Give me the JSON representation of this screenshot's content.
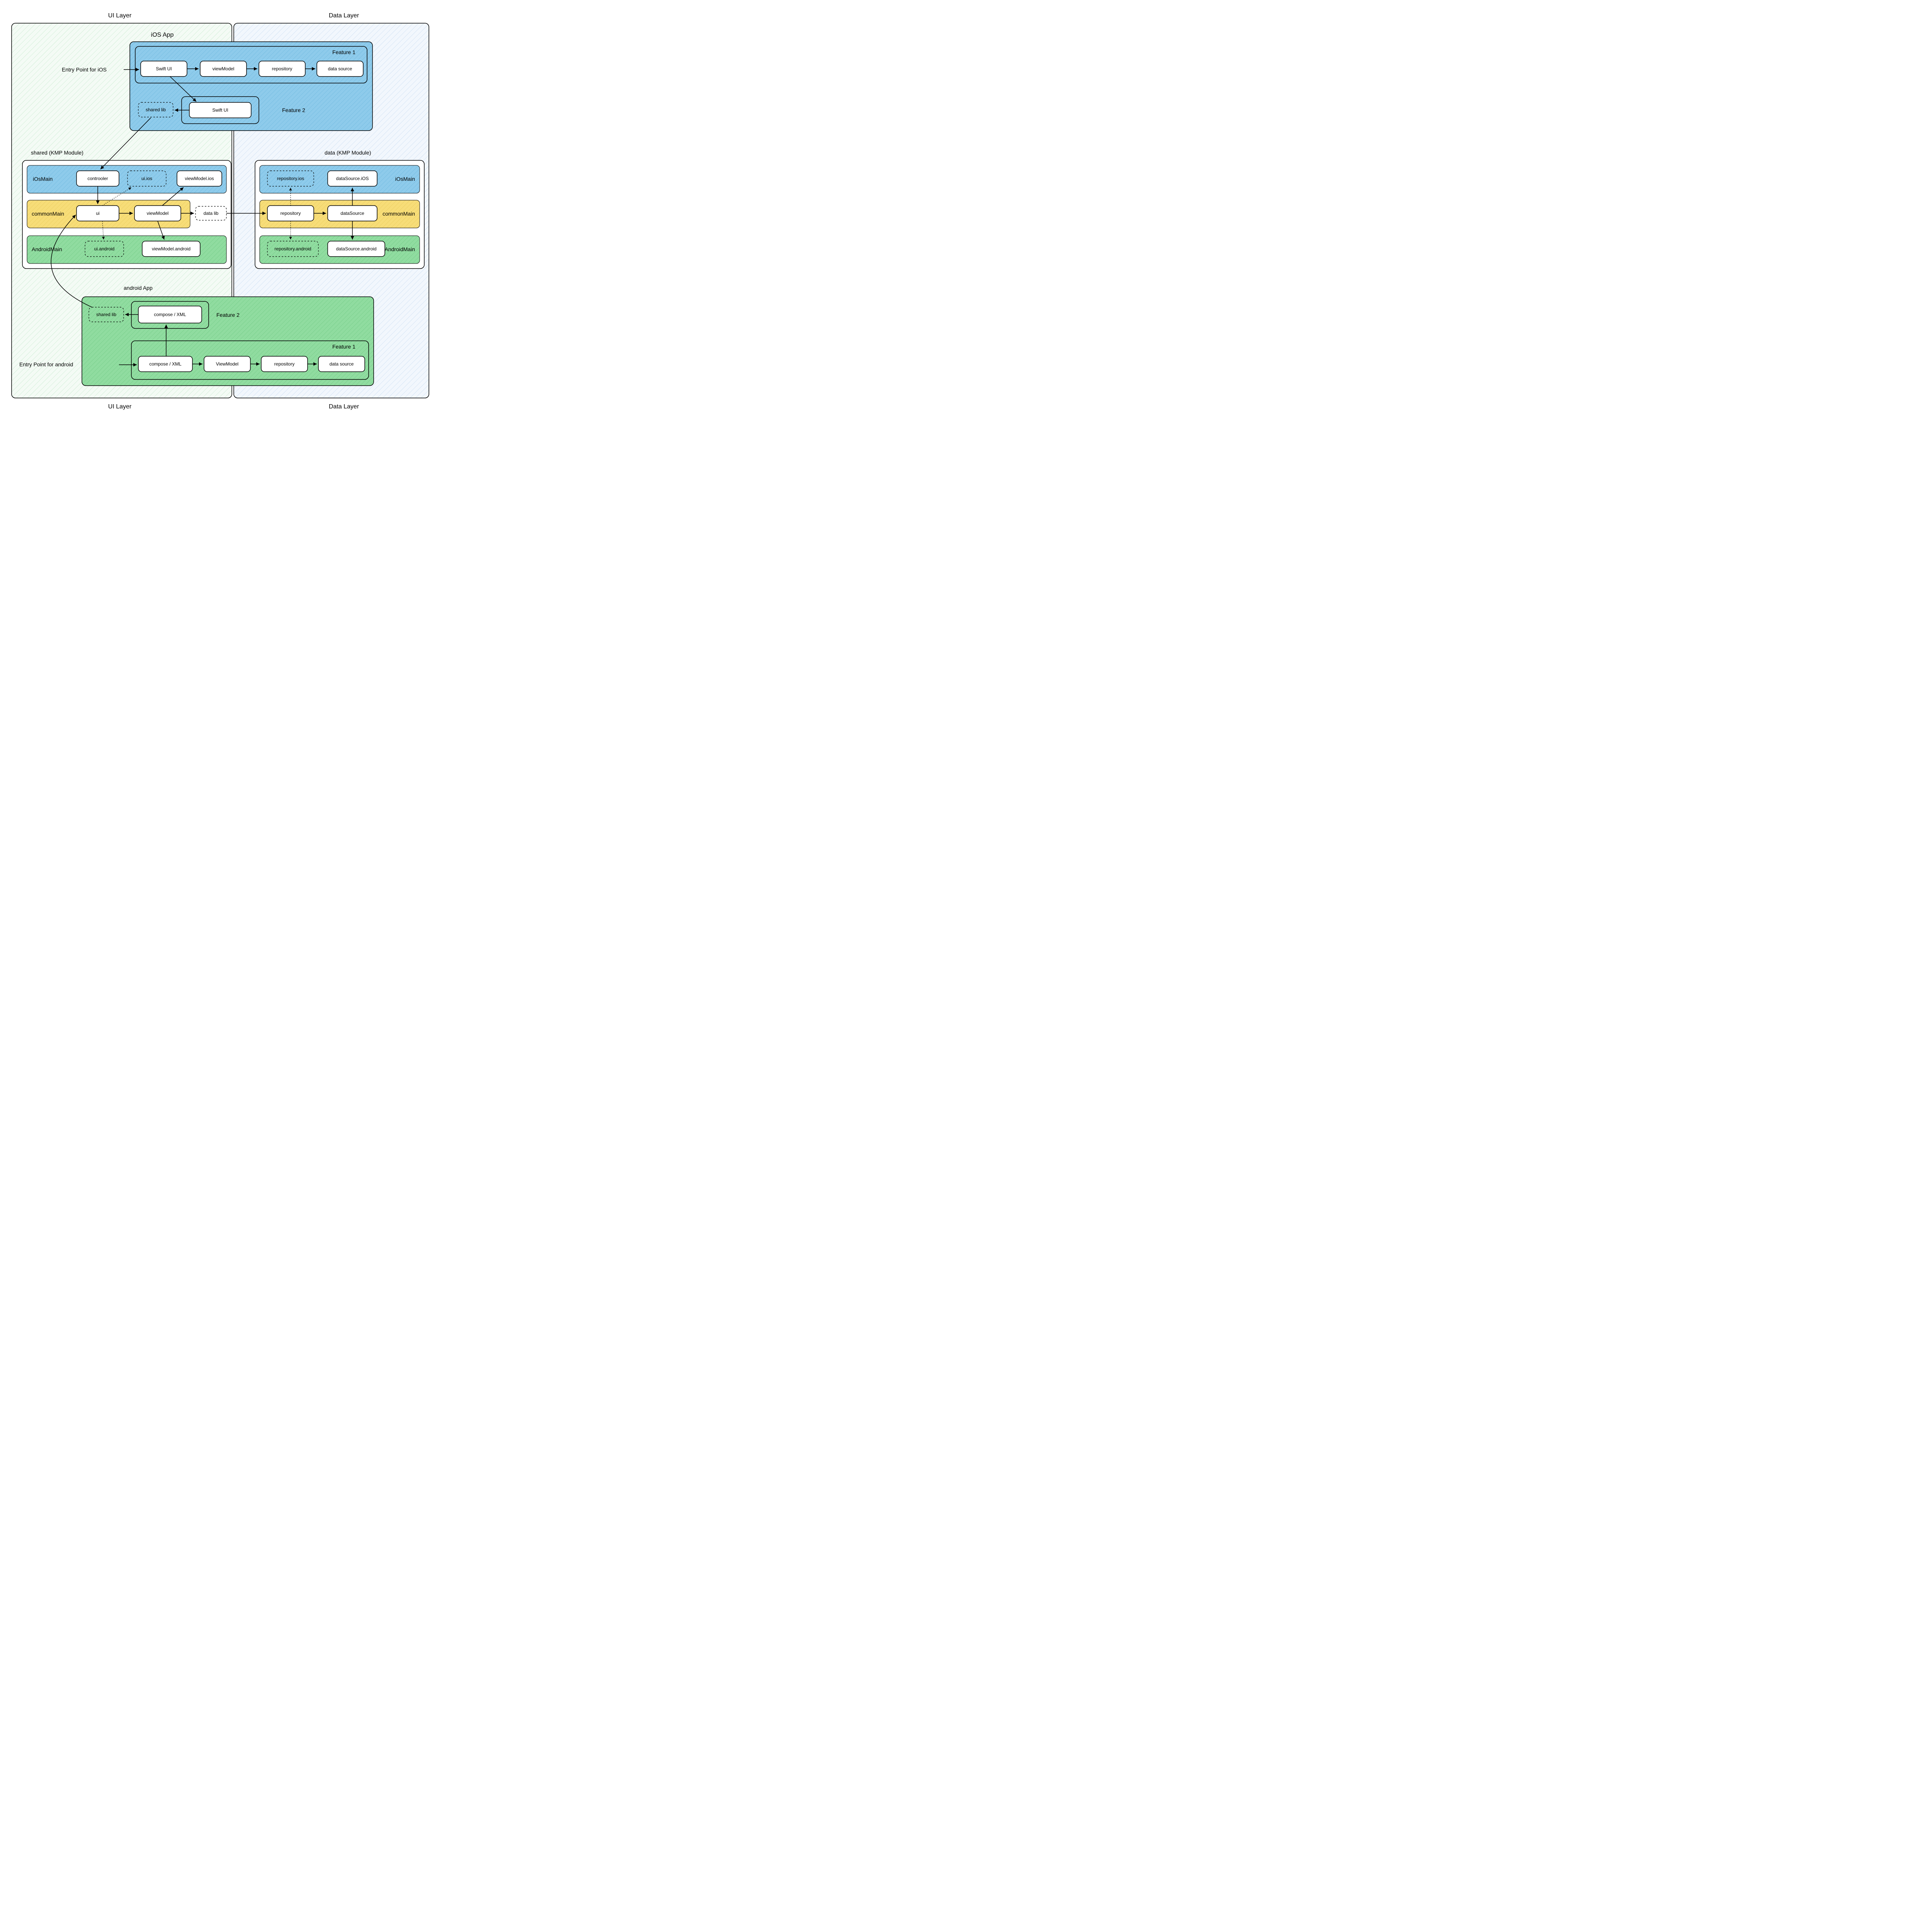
{
  "layers": {
    "ui_top": "UI Layer",
    "data_top": "Data Layer",
    "ui_bottom": "UI Layer",
    "data_bottom": "Data Layer"
  },
  "ios_app": {
    "title": "iOS App",
    "entry": "Entry Point for iOS",
    "feature1": {
      "title": "Feature 1",
      "swift_ui": "Swift UI",
      "viewmodel": "viewModel",
      "repository": "repository",
      "data_source": "data source"
    },
    "feature2": {
      "title": "Feature 2",
      "shared_lib": "shared lib",
      "swift_ui": "Swift UI"
    }
  },
  "shared": {
    "title": "shared (KMP Module)",
    "ios_main": {
      "title": "iOsMain",
      "controller": "controoler",
      "ui_ios": "ui.ios",
      "vm_ios": "viewModel.ios"
    },
    "common_main": {
      "title": "commonMain",
      "ui": "ui",
      "viewmodel": "viewModel",
      "data_lib": "data lib"
    },
    "android_main": {
      "title": "AndroidMain",
      "ui_android": "ui.android",
      "vm_android": "viewModel.android"
    }
  },
  "data_module": {
    "title": "data (KMP Module)",
    "ios_main": {
      "title": "iOsMain",
      "repo_ios": "repository.ios",
      "ds_ios": "dataSource.iOS"
    },
    "common_main": {
      "title": "commonMain",
      "repository": "repository",
      "data_source": "dataSource"
    },
    "android_main": {
      "title": "AndroidMain",
      "repo_android": "repository.android",
      "ds_android": "dataSource.android"
    }
  },
  "android_app": {
    "title": "android App",
    "entry": "Entry Point for android",
    "feature1": {
      "title": "Feature 1",
      "compose": "compose / XML",
      "viewmodel": "ViewModel",
      "repository": "repository",
      "data_source": "data source"
    },
    "feature2": {
      "title": "Feature 2",
      "shared_lib": "shared lib",
      "compose": "compose / XML"
    }
  },
  "colors": {
    "blue_fill": "#79c0e8",
    "green_fill": "#7ed491",
    "yellow_fill": "#f5d662",
    "ui_layer_bg": "#e8f6ec",
    "data_layer_bg": "#e8f0fa"
  }
}
